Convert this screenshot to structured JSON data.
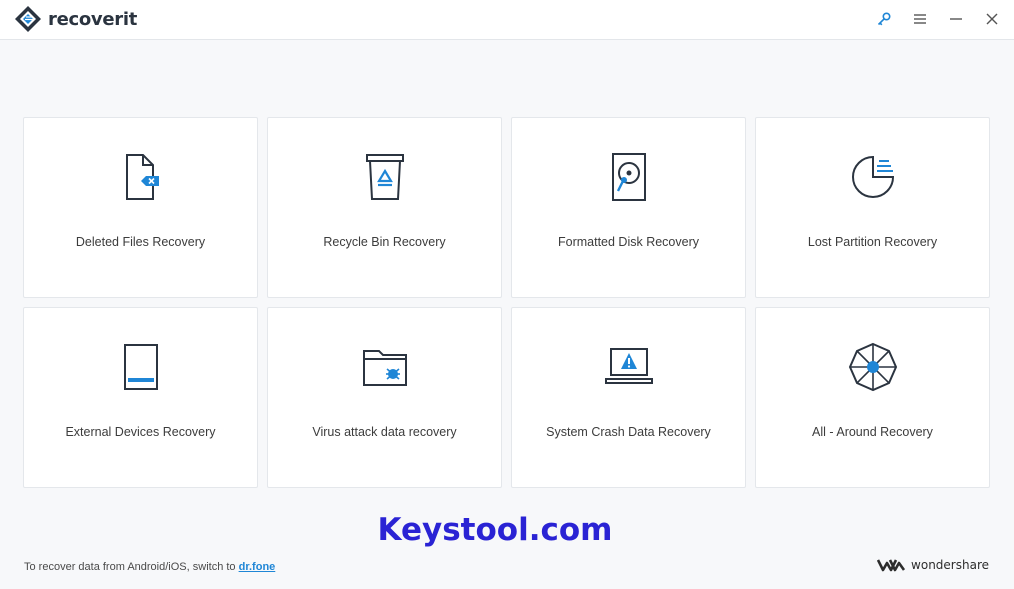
{
  "app": {
    "name": "recoverit"
  },
  "window_controls": [
    {
      "name": "key-icon"
    },
    {
      "name": "menu-icon"
    },
    {
      "name": "minimize-icon"
    },
    {
      "name": "close-icon"
    }
  ],
  "cards": [
    {
      "label": "Deleted Files Recovery",
      "icon": "deleted-file-icon"
    },
    {
      "label": "Recycle Bin Recovery",
      "icon": "recycle-bin-icon"
    },
    {
      "label": "Formatted Disk Recovery",
      "icon": "hard-disk-icon"
    },
    {
      "label": "Lost Partition Recovery",
      "icon": "partition-icon"
    },
    {
      "label": "External Devices Recovery",
      "icon": "external-device-icon"
    },
    {
      "label": "Virus attack data recovery",
      "icon": "virus-folder-icon"
    },
    {
      "label": "System Crash Data Recovery",
      "icon": "crashed-laptop-icon"
    },
    {
      "label": "All - Around Recovery",
      "icon": "all-around-icon"
    }
  ],
  "watermark": "Keystool.com",
  "footer": {
    "note": "To recover data from Android/iOS, switch to",
    "link": "dr.fone"
  },
  "brand": {
    "name": "wondershare"
  },
  "colors": {
    "accent": "#1f86d6",
    "icon_stroke": "#2b3440",
    "watermark": "#2a23d4"
  }
}
